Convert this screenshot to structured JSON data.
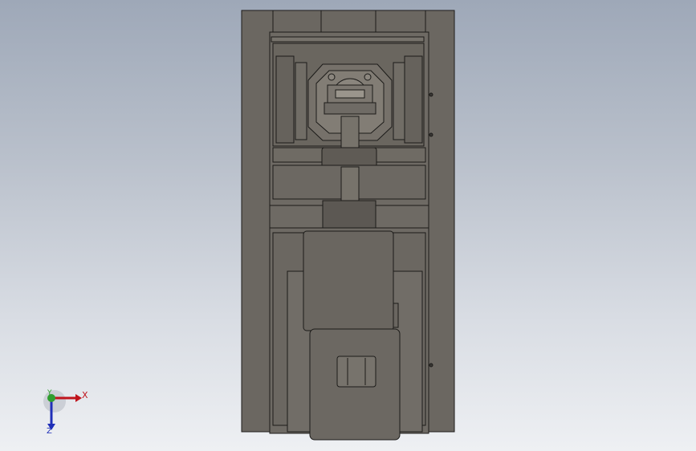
{
  "viewport": {
    "background_top": "#9ea8b8",
    "background_bottom": "#eef0f3",
    "model_body_color": "#6d6963",
    "edge_color": "#1c1b19"
  },
  "triad": {
    "x_label": "X",
    "y_label": "Y",
    "z_label": "Z",
    "x_color": "#c0141c",
    "y_color": "#2f9e2f",
    "z_color": "#1f2fb8"
  }
}
